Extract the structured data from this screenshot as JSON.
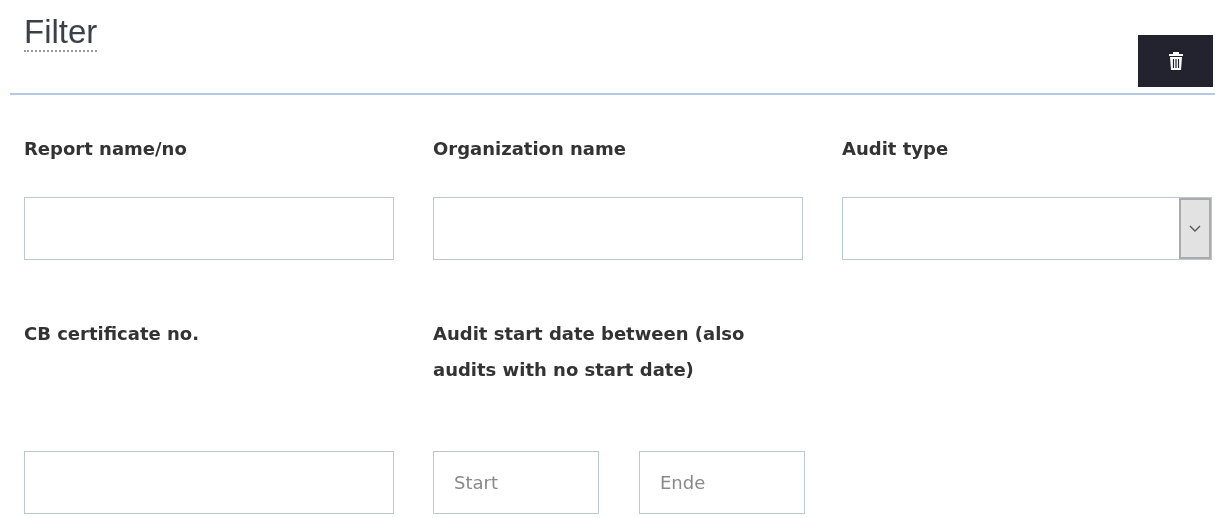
{
  "title": "Filter",
  "fields": [
    {
      "kind": "text",
      "label": "Report name/no"
    },
    {
      "kind": "text",
      "label": "Organization name"
    },
    {
      "kind": "select",
      "label": "Audit type"
    },
    {
      "kind": "text",
      "label": "CB certificate no."
    },
    {
      "kind": "daterange",
      "label": "Audit start date between (also audits with no start date)",
      "placeholders": [
        "Start",
        "Ende"
      ]
    }
  ]
}
